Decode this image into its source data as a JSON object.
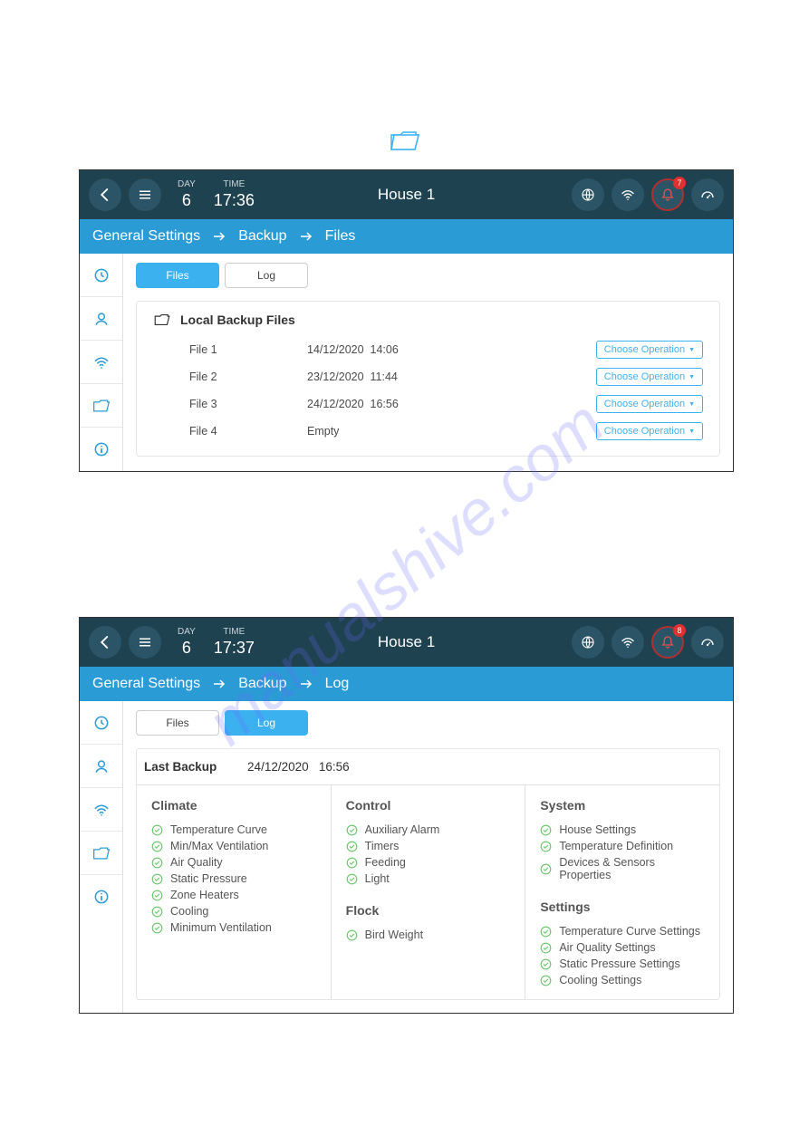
{
  "folder_icon_color": "#3CB1F0",
  "watermark": "manualshive.com",
  "screen1": {
    "header": {
      "day_label": "DAY",
      "day_value": "6",
      "time_label": "TIME",
      "time_value": "17:36",
      "house": "House 1",
      "bell_badge": "7"
    },
    "breadcrumb": [
      "General Settings",
      "Backup",
      "Files"
    ],
    "tabs": {
      "files": "Files",
      "log": "Log",
      "active": "files"
    },
    "panel_title": "Local Backup Files",
    "rows": [
      {
        "name": "File 1",
        "date": "14/12/2020",
        "time": "14:06",
        "op": "Choose Operation"
      },
      {
        "name": "File 2",
        "date": "23/12/2020",
        "time": "11:44",
        "op": "Choose Operation"
      },
      {
        "name": "File 3",
        "date": "24/12/2020",
        "time": "16:56",
        "op": "Choose Operation"
      },
      {
        "name": "File 4",
        "date": "Empty",
        "time": "",
        "op": "Choose Operation"
      }
    ]
  },
  "screen2": {
    "header": {
      "day_label": "DAY",
      "day_value": "6",
      "time_label": "TIME",
      "time_value": "17:37",
      "house": "House 1",
      "bell_badge": "8"
    },
    "breadcrumb": [
      "General Settings",
      "Backup",
      "Log"
    ],
    "tabs": {
      "files": "Files",
      "log": "Log",
      "active": "log"
    },
    "last_backup_label": "Last Backup",
    "last_backup_date": "24/12/2020",
    "last_backup_time": "16:56",
    "columns": {
      "climate": {
        "title": "Climate",
        "items": [
          "Temperature Curve",
          "Min/Max Ventilation",
          "Air Quality",
          "Static Pressure",
          "Zone Heaters",
          "Cooling",
          "Minimum Ventilation"
        ]
      },
      "control": {
        "title": "Control",
        "items": [
          "Auxiliary Alarm",
          "Timers",
          "Feeding",
          "Light"
        ],
        "flock_title": "Flock",
        "flock_items": [
          "Bird Weight"
        ]
      },
      "system": {
        "title": "System",
        "items": [
          "House Settings",
          "Temperature Definition",
          "Devices & Sensors Properties"
        ],
        "settings_title": "Settings",
        "settings_items": [
          "Temperature Curve Settings",
          "Air Quality Settings",
          "Static Pressure Settings",
          "Cooling Settings"
        ]
      }
    }
  }
}
